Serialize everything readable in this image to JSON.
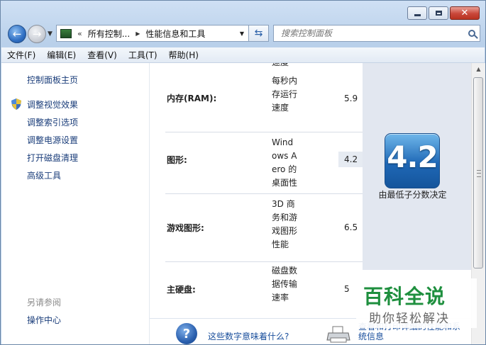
{
  "window": {
    "caption_buttons": [
      "minimize-icon",
      "maximize-icon",
      "close-icon"
    ]
  },
  "navigation": {
    "breadcrumb_overflow": "«",
    "crumbs": [
      "所有控制...",
      "性能信息和工具"
    ],
    "search_placeholder": "搜索控制面板"
  },
  "menu": {
    "items": [
      "文件(F)",
      "编辑(E)",
      "查看(V)",
      "工具(T)",
      "帮助(H)"
    ]
  },
  "sidebar": {
    "home_link": "控制面板主页",
    "tasks": [
      "调整视觉效果",
      "调整索引选项",
      "调整电源设置",
      "打开磁盘清理",
      "高级工具"
    ],
    "see_also_label": "另请参阅",
    "see_also_links": [
      "操作中心"
    ]
  },
  "ratings": {
    "top_partial_desc": "速度",
    "rows": [
      {
        "component": "内存(RAM):",
        "description": "每秒内存运行速度",
        "score": "5.9"
      },
      {
        "component": "图形:",
        "description": "Windows Aero 的桌面性能",
        "score": "4.2"
      },
      {
        "component": "游戏图形:",
        "description": "3D 商务和游戏图形性能",
        "score": "6.5"
      },
      {
        "component": "主硬盘:",
        "description": "磁盘数据传输速率",
        "score": "5"
      }
    ],
    "base_score": "4.2",
    "base_caption": "由最低子分数决定"
  },
  "help": {
    "what_link": "这些数字意味着什么?",
    "print_link": "查看和打印详细的性能和系统信息"
  },
  "watermark": {
    "title": "百科全说",
    "subtitle": "助你轻松解决"
  },
  "colors": {
    "link": "#1a3d7a",
    "badge": "#1f68b6",
    "watermark": "#1e8f3e"
  }
}
